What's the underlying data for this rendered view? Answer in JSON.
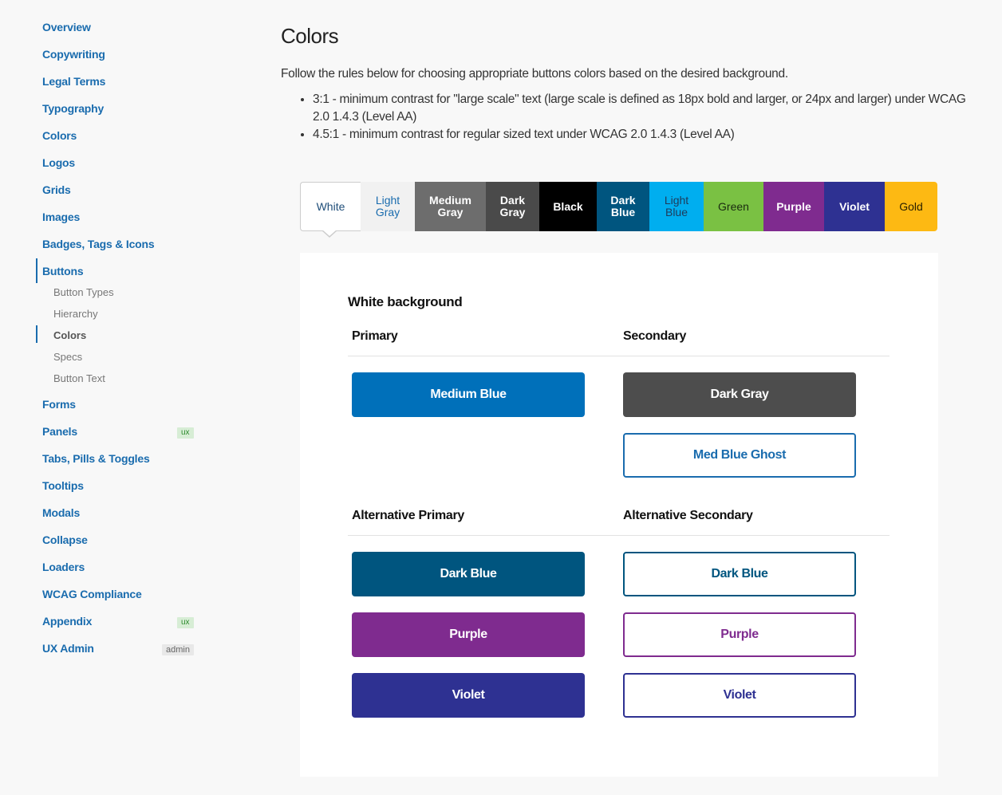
{
  "sidebar": {
    "items": [
      {
        "label": "Overview"
      },
      {
        "label": "Copywriting"
      },
      {
        "label": "Legal Terms"
      },
      {
        "label": "Typography"
      },
      {
        "label": "Colors"
      },
      {
        "label": "Logos"
      },
      {
        "label": "Grids"
      },
      {
        "label": "Images"
      },
      {
        "label": "Badges, Tags & Icons"
      },
      {
        "label": "Buttons",
        "active": true
      },
      {
        "label": "Forms"
      },
      {
        "label": "Panels",
        "badge": "ux"
      },
      {
        "label": "Tabs, Pills & Toggles"
      },
      {
        "label": "Tooltips"
      },
      {
        "label": "Modals"
      },
      {
        "label": "Collapse"
      },
      {
        "label": "Loaders"
      },
      {
        "label": "WCAG Compliance"
      },
      {
        "label": "Appendix",
        "badge": "ux"
      },
      {
        "label": "UX Admin",
        "badge": "admin"
      }
    ],
    "sub_items": [
      {
        "label": "Button Types"
      },
      {
        "label": "Hierarchy"
      },
      {
        "label": "Colors",
        "active": true
      },
      {
        "label": "Specs"
      },
      {
        "label": "Button Text"
      }
    ]
  },
  "main": {
    "title": "Colors",
    "intro": "Follow the rules below for choosing appropriate buttons colors based on the desired background.",
    "rules": [
      "3:1 - minimum contrast for \"large scale\" text (large scale is defined as 18px bold and larger, or 24px and larger) under WCAG 2.0 1.4.3 (Level AA)",
      "4.5:1 - minimum contrast for regular sized text under WCAG 2.0 1.4.3 (Level AA)"
    ],
    "color_tabs": [
      {
        "label": "White",
        "bg": "#ffffff",
        "fg": "#1f4e79",
        "selected": true
      },
      {
        "label": "Light Gray",
        "bg": "#f1f1f1",
        "fg": "#1a6cae"
      },
      {
        "label": "Medium Gray",
        "bg": "#6d6d6d",
        "fg": "#ffffff"
      },
      {
        "label": "Dark Gray",
        "bg": "#4a4a4a",
        "fg": "#ffffff"
      },
      {
        "label": "Black",
        "bg": "#000000",
        "fg": "#ffffff"
      },
      {
        "label": "Dark Blue",
        "bg": "#00557f",
        "fg": "#ffffff"
      },
      {
        "label": "Light Blue",
        "bg": "#00aeef",
        "fg": "#1f3b5a"
      },
      {
        "label": "Green",
        "bg": "#7ac143",
        "fg": "#1a2a10"
      },
      {
        "label": "Purple",
        "bg": "#7f2b8f",
        "fg": "#ffffff"
      },
      {
        "label": "Violet",
        "bg": "#2e3192",
        "fg": "#ffffff"
      },
      {
        "label": "Gold",
        "bg": "#fdb913",
        "fg": "#2a2000"
      }
    ],
    "panel": {
      "title": "White background",
      "sections": [
        {
          "primary_heading": "Primary",
          "secondary_heading": "Secondary",
          "primary_buttons": [
            {
              "label": "Medium Blue",
              "style": "solid",
              "color": "#0070ba"
            }
          ],
          "secondary_buttons": [
            {
              "label": "Dark Gray",
              "style": "solid",
              "color": "#4d4d4d"
            },
            {
              "label": "Med Blue Ghost",
              "style": "ghost",
              "color": "#1a6cae"
            }
          ]
        },
        {
          "primary_heading": "Alternative Primary",
          "secondary_heading": "Alternative Secondary",
          "primary_buttons": [
            {
              "label": "Dark Blue",
              "style": "solid",
              "color": "#00557f"
            },
            {
              "label": "Purple",
              "style": "solid",
              "color": "#7f2b8f"
            },
            {
              "label": "Violet",
              "style": "solid",
              "color": "#2e3192"
            }
          ],
          "secondary_buttons": [
            {
              "label": "Dark Blue",
              "style": "ghost",
              "color": "#00557f"
            },
            {
              "label": "Purple",
              "style": "ghost",
              "color": "#7f2b8f"
            },
            {
              "label": "Violet",
              "style": "ghost",
              "color": "#2e3192"
            }
          ]
        }
      ]
    }
  }
}
